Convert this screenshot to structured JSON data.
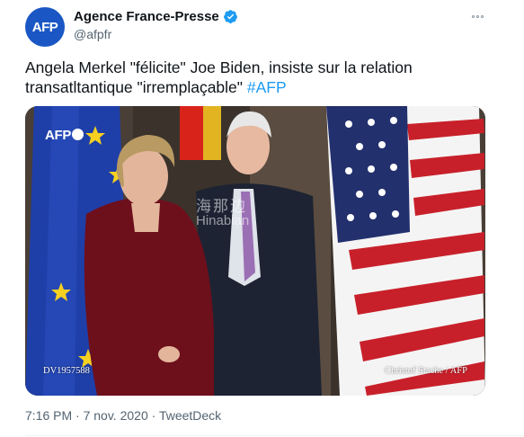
{
  "account": {
    "display_name": "Agence France-Presse",
    "handle": "@afpfr",
    "avatar_text": "AFP",
    "verified": true,
    "avatar_color": "#1a57c4"
  },
  "menu": {
    "icon": "more-horizontal-icon"
  },
  "tweet": {
    "text_line1": "Angela Merkel \"félicite\" Joe Biden, insiste sur la relation",
    "text_line2": "transatltantique \"irremplaçable\" ",
    "hashtag": "#AFP",
    "hashtag_color": "#1d9bf0"
  },
  "media": {
    "logo_text": "AFP",
    "caption_left": "DV1957588",
    "caption_right": "Christof Stache / AFP",
    "watermark_cn": "海那边",
    "watermark_en": "Hinabian"
  },
  "footer": {
    "time": "7:16 PM",
    "separator1": " · ",
    "date": "7 nov. 2020",
    "separator2": " · ",
    "source": "TweetDeck"
  }
}
